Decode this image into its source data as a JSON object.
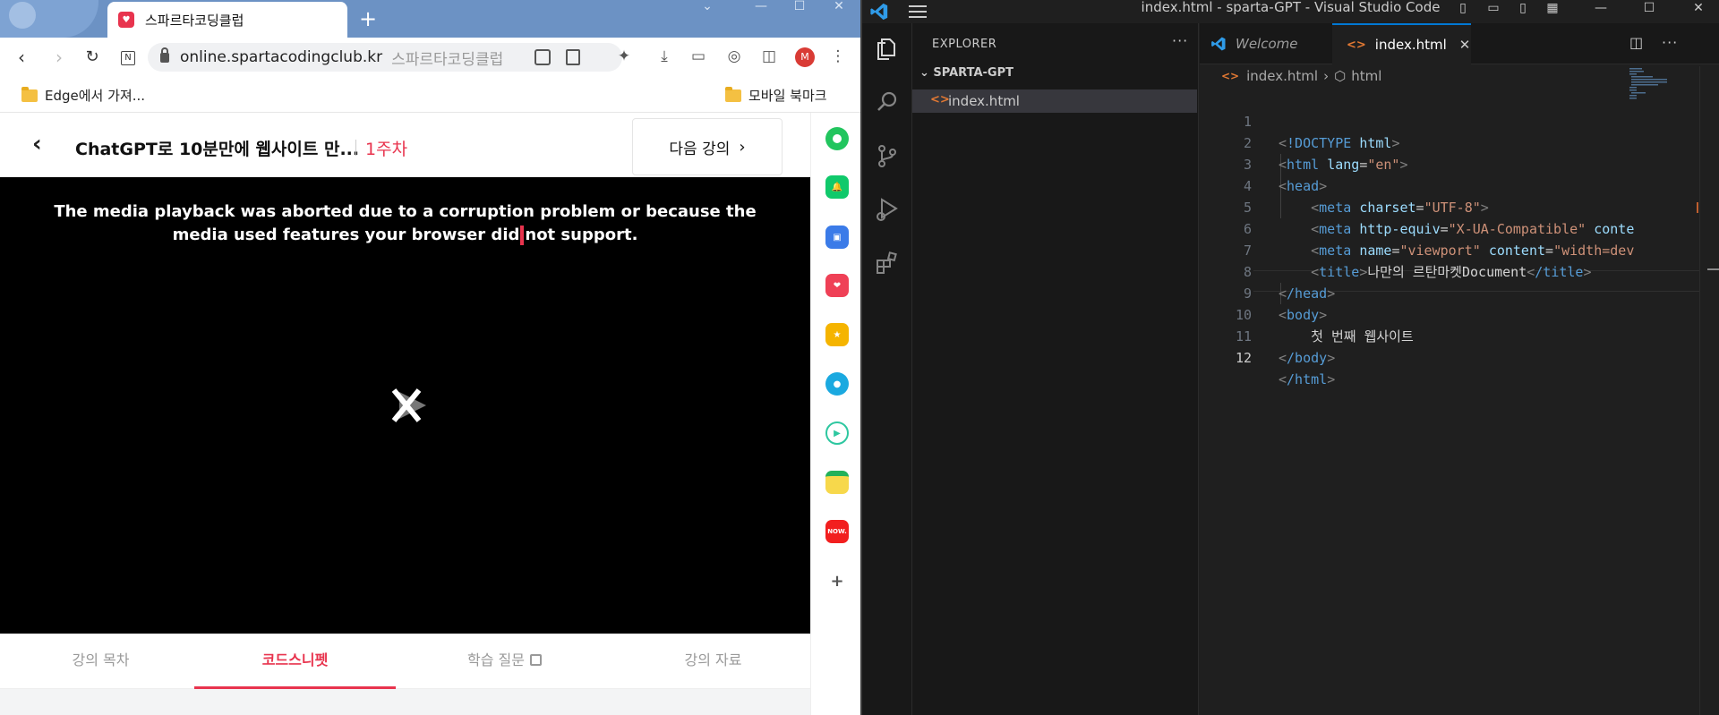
{
  "edge": {
    "tab_title": "스파르타코딩클럽",
    "url": "online.spartacodingclub.kr",
    "url_site_name": "스파르타코딩클럽",
    "bookmarks": [
      "Edge에서 가져...",
      "모바일 북마크"
    ],
    "profile_initial": "M",
    "lecture": {
      "title": "ChatGPT로 10분만에 웹사이트 만...",
      "week": "1주차",
      "next_label": "다음 강의"
    },
    "video_error_part1": "The media playback was aborted due to a corruption problem or because the media used features your browser did",
    "video_error_part2": "not support.",
    "lesson_tabs": [
      "강의 목차",
      "코드스니펫",
      "학습 질문",
      "강의 자료"
    ],
    "active_lesson_tab": "코드스니펫",
    "sidebar_icons": [
      "copilot-icon",
      "bell-icon",
      "briefcase-icon",
      "pocket-icon",
      "star-icon",
      "papago-icon",
      "media-icon",
      "notes-icon",
      "now-icon",
      "add-icon"
    ],
    "now_badge": "NOW.",
    "accent": "#e8344e"
  },
  "vscode": {
    "title": "index.html - sparta-GPT - Visual Studio Code",
    "explorer_header": "EXPLORER",
    "project": "SPARTA-GPT",
    "file": "index.html",
    "tabs": [
      {
        "label": "Welcome",
        "active": false
      },
      {
        "label": "index.html",
        "active": true
      }
    ],
    "breadcrumb": [
      "index.html",
      "html"
    ],
    "line_numbers": [
      "1",
      "2",
      "3",
      "4",
      "5",
      "6",
      "7",
      "8",
      "9",
      "10",
      "11",
      "12"
    ],
    "current_line": "12",
    "code": {
      "l1_doctype": "!DOCTYPE",
      "l1_html": "html",
      "l2_tag": "html",
      "l2_attr": "lang",
      "l2_val": "\"en\"",
      "l3_tag": "head",
      "l4_tag": "meta",
      "l4_attr": "charset",
      "l4_val": "\"UTF-8\"",
      "l5_tag": "meta",
      "l5_attr": "http-equiv",
      "l5_val": "\"X-UA-Compatible\"",
      "l5_attr2": "conte",
      "l6_tag": "meta",
      "l6_attr": "name",
      "l6_val": "\"viewport\"",
      "l6_attr2": "content",
      "l6_val2": "\"width=dev",
      "l7_tag": "title",
      "l7_text": "나만의 르탄마켓Document",
      "l7_close": "/title",
      "l8_tag": "/head",
      "l9_tag": "body",
      "l10_text": "첫 번째 웹사이트",
      "l11_tag": "/body",
      "l12_tag": "/html"
    },
    "accent": "#0078d4"
  }
}
